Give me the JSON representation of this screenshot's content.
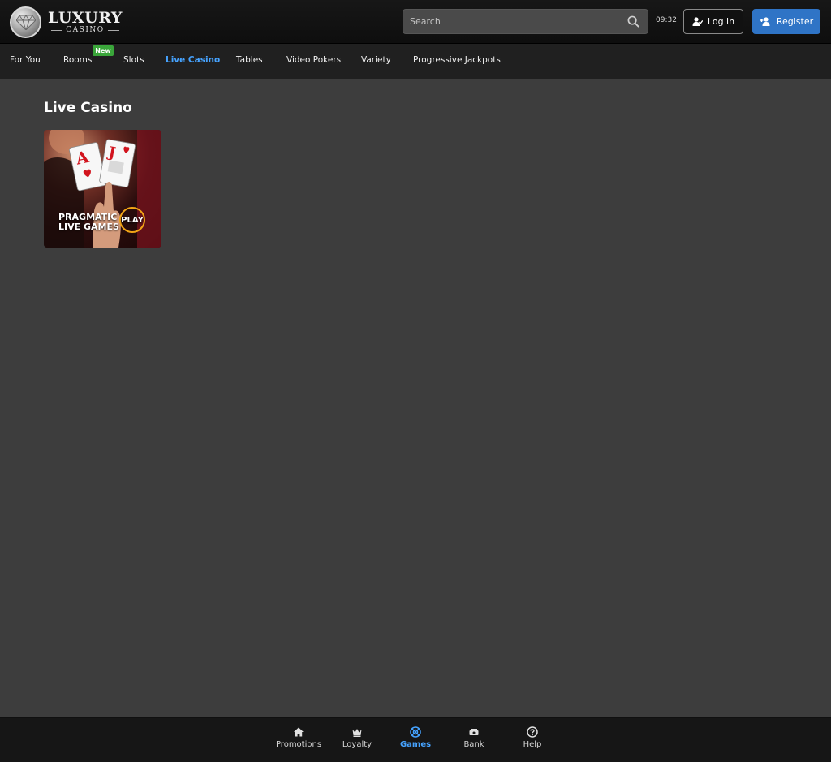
{
  "header": {
    "logo_main": "LUXURY",
    "logo_sub": "CASINO",
    "search_placeholder": "Search",
    "time": "09:32",
    "login_label": "Log in",
    "register_label": "Register",
    "accent_color": "#2f74c6"
  },
  "catnav": {
    "items": [
      {
        "label": "For You",
        "active": false
      },
      {
        "label": "Rooms",
        "active": false,
        "badge": "New"
      },
      {
        "label": "Slots",
        "active": false
      },
      {
        "label": "Live Casino",
        "active": true
      },
      {
        "label": "Tables",
        "active": false
      },
      {
        "label": "Video Pokers",
        "active": false
      },
      {
        "label": "Variety",
        "active": false
      },
      {
        "label": "Progressive Jackpots",
        "active": false
      }
    ],
    "active_color": "#46a3ff",
    "badge_color": "#3aa63a"
  },
  "main": {
    "title": "Live Casino",
    "games": [
      {
        "line1": "PRAGMATIC",
        "line2": "LIVE GAMES",
        "play": "PLAY",
        "icon": "playing-cards-thumbnail"
      }
    ]
  },
  "bottom_nav": {
    "items": [
      {
        "label": "Promotions",
        "icon": "home-icon",
        "active": false
      },
      {
        "label": "Loyalty",
        "icon": "crown-icon",
        "active": false
      },
      {
        "label": "Games",
        "icon": "games-icon",
        "active": true
      },
      {
        "label": "Bank",
        "icon": "bank-icon",
        "active": false
      },
      {
        "label": "Help",
        "icon": "help-icon",
        "active": false
      }
    ]
  }
}
